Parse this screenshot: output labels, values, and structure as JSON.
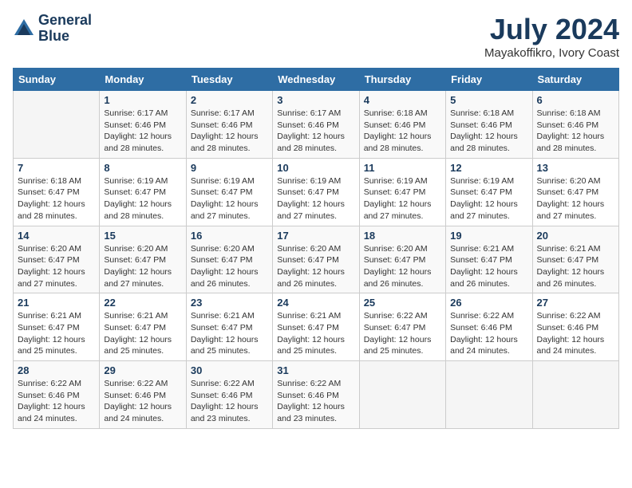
{
  "header": {
    "logo_line1": "General",
    "logo_line2": "Blue",
    "month_title": "July 2024",
    "location": "Mayakoffikro, Ivory Coast"
  },
  "days_of_week": [
    "Sunday",
    "Monday",
    "Tuesday",
    "Wednesday",
    "Thursday",
    "Friday",
    "Saturday"
  ],
  "weeks": [
    [
      {
        "day": "",
        "sunrise": "",
        "sunset": "",
        "daylight": ""
      },
      {
        "day": "1",
        "sunrise": "Sunrise: 6:17 AM",
        "sunset": "Sunset: 6:46 PM",
        "daylight": "Daylight: 12 hours and 28 minutes."
      },
      {
        "day": "2",
        "sunrise": "Sunrise: 6:17 AM",
        "sunset": "Sunset: 6:46 PM",
        "daylight": "Daylight: 12 hours and 28 minutes."
      },
      {
        "day": "3",
        "sunrise": "Sunrise: 6:17 AM",
        "sunset": "Sunset: 6:46 PM",
        "daylight": "Daylight: 12 hours and 28 minutes."
      },
      {
        "day": "4",
        "sunrise": "Sunrise: 6:18 AM",
        "sunset": "Sunset: 6:46 PM",
        "daylight": "Daylight: 12 hours and 28 minutes."
      },
      {
        "day": "5",
        "sunrise": "Sunrise: 6:18 AM",
        "sunset": "Sunset: 6:46 PM",
        "daylight": "Daylight: 12 hours and 28 minutes."
      },
      {
        "day": "6",
        "sunrise": "Sunrise: 6:18 AM",
        "sunset": "Sunset: 6:46 PM",
        "daylight": "Daylight: 12 hours and 28 minutes."
      }
    ],
    [
      {
        "day": "7",
        "sunrise": "Sunrise: 6:18 AM",
        "sunset": "Sunset: 6:47 PM",
        "daylight": "Daylight: 12 hours and 28 minutes."
      },
      {
        "day": "8",
        "sunrise": "Sunrise: 6:19 AM",
        "sunset": "Sunset: 6:47 PM",
        "daylight": "Daylight: 12 hours and 28 minutes."
      },
      {
        "day": "9",
        "sunrise": "Sunrise: 6:19 AM",
        "sunset": "Sunset: 6:47 PM",
        "daylight": "Daylight: 12 hours and 27 minutes."
      },
      {
        "day": "10",
        "sunrise": "Sunrise: 6:19 AM",
        "sunset": "Sunset: 6:47 PM",
        "daylight": "Daylight: 12 hours and 27 minutes."
      },
      {
        "day": "11",
        "sunrise": "Sunrise: 6:19 AM",
        "sunset": "Sunset: 6:47 PM",
        "daylight": "Daylight: 12 hours and 27 minutes."
      },
      {
        "day": "12",
        "sunrise": "Sunrise: 6:19 AM",
        "sunset": "Sunset: 6:47 PM",
        "daylight": "Daylight: 12 hours and 27 minutes."
      },
      {
        "day": "13",
        "sunrise": "Sunrise: 6:20 AM",
        "sunset": "Sunset: 6:47 PM",
        "daylight": "Daylight: 12 hours and 27 minutes."
      }
    ],
    [
      {
        "day": "14",
        "sunrise": "Sunrise: 6:20 AM",
        "sunset": "Sunset: 6:47 PM",
        "daylight": "Daylight: 12 hours and 27 minutes."
      },
      {
        "day": "15",
        "sunrise": "Sunrise: 6:20 AM",
        "sunset": "Sunset: 6:47 PM",
        "daylight": "Daylight: 12 hours and 27 minutes."
      },
      {
        "day": "16",
        "sunrise": "Sunrise: 6:20 AM",
        "sunset": "Sunset: 6:47 PM",
        "daylight": "Daylight: 12 hours and 26 minutes."
      },
      {
        "day": "17",
        "sunrise": "Sunrise: 6:20 AM",
        "sunset": "Sunset: 6:47 PM",
        "daylight": "Daylight: 12 hours and 26 minutes."
      },
      {
        "day": "18",
        "sunrise": "Sunrise: 6:20 AM",
        "sunset": "Sunset: 6:47 PM",
        "daylight": "Daylight: 12 hours and 26 minutes."
      },
      {
        "day": "19",
        "sunrise": "Sunrise: 6:21 AM",
        "sunset": "Sunset: 6:47 PM",
        "daylight": "Daylight: 12 hours and 26 minutes."
      },
      {
        "day": "20",
        "sunrise": "Sunrise: 6:21 AM",
        "sunset": "Sunset: 6:47 PM",
        "daylight": "Daylight: 12 hours and 26 minutes."
      }
    ],
    [
      {
        "day": "21",
        "sunrise": "Sunrise: 6:21 AM",
        "sunset": "Sunset: 6:47 PM",
        "daylight": "Daylight: 12 hours and 25 minutes."
      },
      {
        "day": "22",
        "sunrise": "Sunrise: 6:21 AM",
        "sunset": "Sunset: 6:47 PM",
        "daylight": "Daylight: 12 hours and 25 minutes."
      },
      {
        "day": "23",
        "sunrise": "Sunrise: 6:21 AM",
        "sunset": "Sunset: 6:47 PM",
        "daylight": "Daylight: 12 hours and 25 minutes."
      },
      {
        "day": "24",
        "sunrise": "Sunrise: 6:21 AM",
        "sunset": "Sunset: 6:47 PM",
        "daylight": "Daylight: 12 hours and 25 minutes."
      },
      {
        "day": "25",
        "sunrise": "Sunrise: 6:22 AM",
        "sunset": "Sunset: 6:47 PM",
        "daylight": "Daylight: 12 hours and 25 minutes."
      },
      {
        "day": "26",
        "sunrise": "Sunrise: 6:22 AM",
        "sunset": "Sunset: 6:46 PM",
        "daylight": "Daylight: 12 hours and 24 minutes."
      },
      {
        "day": "27",
        "sunrise": "Sunrise: 6:22 AM",
        "sunset": "Sunset: 6:46 PM",
        "daylight": "Daylight: 12 hours and 24 minutes."
      }
    ],
    [
      {
        "day": "28",
        "sunrise": "Sunrise: 6:22 AM",
        "sunset": "Sunset: 6:46 PM",
        "daylight": "Daylight: 12 hours and 24 minutes."
      },
      {
        "day": "29",
        "sunrise": "Sunrise: 6:22 AM",
        "sunset": "Sunset: 6:46 PM",
        "daylight": "Daylight: 12 hours and 24 minutes."
      },
      {
        "day": "30",
        "sunrise": "Sunrise: 6:22 AM",
        "sunset": "Sunset: 6:46 PM",
        "daylight": "Daylight: 12 hours and 23 minutes."
      },
      {
        "day": "31",
        "sunrise": "Sunrise: 6:22 AM",
        "sunset": "Sunset: 6:46 PM",
        "daylight": "Daylight: 12 hours and 23 minutes."
      },
      {
        "day": "",
        "sunrise": "",
        "sunset": "",
        "daylight": ""
      },
      {
        "day": "",
        "sunrise": "",
        "sunset": "",
        "daylight": ""
      },
      {
        "day": "",
        "sunrise": "",
        "sunset": "",
        "daylight": ""
      }
    ]
  ]
}
